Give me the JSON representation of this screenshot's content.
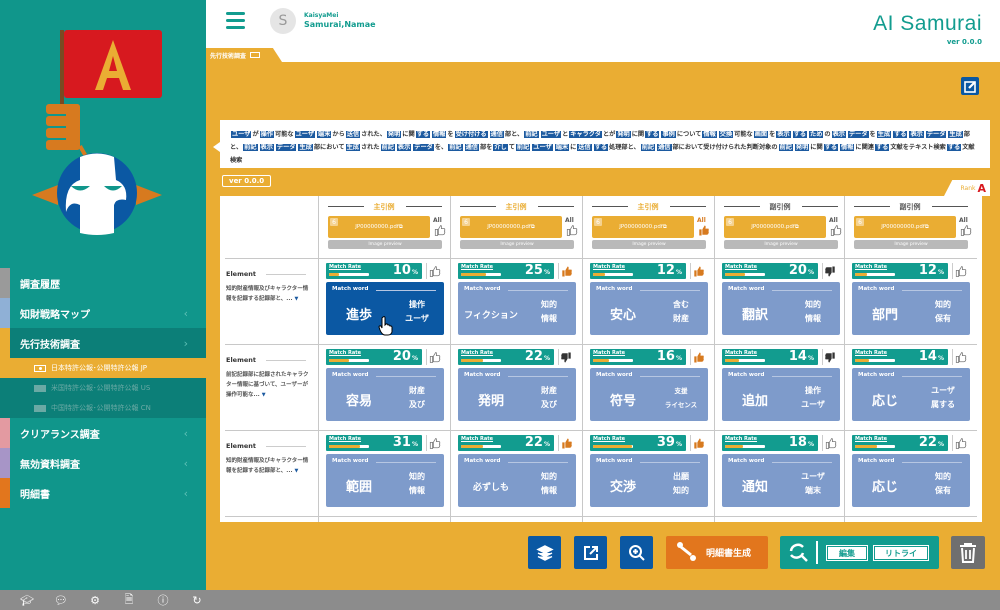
{
  "app": {
    "brand": "AI Samurai",
    "version": "ver 0.0.0"
  },
  "user": {
    "initial": "S",
    "company": "KaisyaMei",
    "name": "Samurai,Namae"
  },
  "breadcrumb_tab": "先行技術調査",
  "sidebar": {
    "items": [
      {
        "label": "調査履歴",
        "strip": "#9a9a9a",
        "chevron": ""
      },
      {
        "label": "知財戦略マップ",
        "strip": "#8fb0d6",
        "chevron": "‹"
      },
      {
        "label": "先行技術調査",
        "strip": "#eaad33",
        "chevron": "›",
        "active": true
      },
      {
        "label": "クリアランス調査",
        "strip": "#e39aa1",
        "chevron": "‹"
      },
      {
        "label": "無効資料調査",
        "strip": "#a795c7",
        "chevron": "‹"
      },
      {
        "label": "明細書",
        "strip": "#e2761d",
        "chevron": "‹"
      }
    ],
    "sub_items": [
      {
        "label": "日本特許公報･公開特許公報 JP",
        "active": true
      },
      {
        "label": "米国特許公報･公開特許公報 US",
        "active": false
      },
      {
        "label": "中国特許公報･公開特許公報 CN",
        "active": false
      }
    ]
  },
  "footer_icons": [
    "graduation-cap-icon",
    "faq-icon",
    "gear-icon",
    "document-icon",
    "help-icon",
    "refresh-icon"
  ],
  "claim": {
    "segments": [
      [
        "ユーザ",
        1
      ],
      [
        "が",
        0
      ],
      [
        "操作",
        1
      ],
      [
        "可能な",
        0
      ],
      [
        "ユーザ",
        1
      ],
      [
        "端末",
        1
      ],
      [
        "から",
        0
      ],
      [
        "送信",
        1
      ],
      [
        "された、",
        0
      ],
      [
        "発明",
        1
      ],
      [
        "に関",
        0
      ],
      [
        "する",
        1
      ],
      [
        "情報",
        1
      ],
      [
        "を",
        0
      ],
      [
        "受け付ける",
        1
      ],
      [
        "通信",
        1
      ],
      [
        "部と、",
        0
      ],
      [
        "前記",
        1
      ],
      [
        "ユーザ",
        1
      ],
      [
        "と",
        0
      ],
      [
        "キャラクタ",
        1
      ],
      [
        "とが",
        0
      ],
      [
        "発明",
        1
      ],
      [
        "に関",
        0
      ],
      [
        "する",
        1
      ],
      [
        "事例",
        1
      ],
      [
        "について",
        0
      ],
      [
        "情報",
        1
      ],
      [
        "交換",
        1
      ],
      [
        "可能な",
        0
      ],
      [
        "画面",
        1
      ],
      [
        "を",
        0
      ],
      [
        "表示",
        1
      ],
      [
        "する",
        1
      ],
      [
        "ため",
        1
      ],
      [
        "の",
        0
      ],
      [
        "表示",
        1
      ],
      [
        "データ",
        1
      ],
      [
        "を",
        0
      ],
      [
        "生成",
        1
      ],
      [
        "する",
        1
      ],
      [
        "表示",
        1
      ],
      [
        "データ",
        1
      ],
      [
        "生成",
        1
      ],
      [
        "部と、",
        0
      ],
      [
        "前記",
        1
      ],
      [
        "表示",
        1
      ],
      [
        "データ",
        1
      ],
      [
        "生成",
        1
      ],
      [
        "部において",
        0
      ],
      [
        "生成",
        1
      ],
      [
        "された",
        0
      ],
      [
        "前記",
        1
      ],
      [
        "表示",
        1
      ],
      [
        "データ",
        1
      ],
      [
        "を、",
        0
      ],
      [
        "前記",
        1
      ],
      [
        "通信",
        1
      ],
      [
        "部を",
        0
      ],
      [
        "介し",
        1
      ],
      [
        "て",
        0
      ],
      [
        "前記",
        1
      ],
      [
        "ユーザ",
        1
      ],
      [
        "端末",
        1
      ],
      [
        "に",
        0
      ],
      [
        "送信",
        1
      ],
      [
        "する",
        1
      ],
      [
        "処理部と、",
        0
      ],
      [
        "前記",
        1
      ],
      [
        "通信",
        1
      ],
      [
        "部において受け付けられた判断対象の",
        0
      ],
      [
        "前記",
        1
      ],
      [
        "発明",
        1
      ],
      [
        "に関",
        0
      ],
      [
        "する",
        1
      ],
      [
        "情報",
        1
      ],
      [
        "に関連",
        0
      ],
      [
        "する",
        1
      ],
      [
        "文献をテキスト検索",
        0
      ],
      [
        "する",
        1
      ],
      [
        "文献検索",
        0
      ]
    ]
  },
  "version_badge": "ver 0.0.0",
  "rank": {
    "label": "Rank",
    "value": "A"
  },
  "columns": [
    {
      "title": "主引例",
      "type": "main",
      "count": "6",
      "pdf": "JP00000000.pdf",
      "all": "All",
      "all_liked": false,
      "preview": "Image preview"
    },
    {
      "title": "主引例",
      "type": "main",
      "count": "6",
      "pdf": "JP00000000.pdf",
      "all": "All",
      "all_liked": false,
      "preview": "Image preview"
    },
    {
      "title": "主引例",
      "type": "main",
      "count": "6",
      "pdf": "JP00000000.pdf",
      "all": "All",
      "all_liked": true,
      "preview": "Image preview"
    },
    {
      "title": "副引例",
      "type": "sub",
      "count": "6",
      "pdf": "JP00000000.pdf",
      "all": "All",
      "all_liked": false,
      "preview": "Image preview"
    },
    {
      "title": "副引例",
      "type": "sub",
      "count": "6",
      "pdf": "JP00000000.pdf",
      "all": "All",
      "all_liked": false,
      "preview": "Image preview"
    }
  ],
  "labels": {
    "element": "Element",
    "match_rate": "Match Rate",
    "match_word": "Match word",
    "percent": "%",
    "more": "▼"
  },
  "rows": [
    {
      "desc": "知的財産情報及びキャラクター情報を記録する記録部と、...",
      "cells": [
        {
          "rate": 10,
          "thumb": "outline",
          "word": "進歩",
          "subs": [
            "操作",
            "ユーザ"
          ],
          "selected": true
        },
        {
          "rate": 25,
          "thumb": "up",
          "word": "フィクション",
          "subs": [
            "知的",
            "情報"
          ]
        },
        {
          "rate": 12,
          "thumb": "up",
          "word": "安心",
          "subs": [
            "含む",
            "財産"
          ]
        },
        {
          "rate": 20,
          "thumb": "down",
          "word": "翻訳",
          "subs": [
            "知的",
            "情報"
          ]
        },
        {
          "rate": 12,
          "thumb": "outline",
          "word": "部門",
          "subs": [
            "知的",
            "保有"
          ]
        }
      ]
    },
    {
      "desc": "前記記録部に記録されたキャラクター情報に基づいて、ユーザーが操作可能な...",
      "cells": [
        {
          "rate": 20,
          "thumb": "outline",
          "word": "容易",
          "subs": [
            "財産",
            "及び"
          ]
        },
        {
          "rate": 22,
          "thumb": "down",
          "word": "発明",
          "subs": [
            "財産",
            "及び"
          ]
        },
        {
          "rate": 16,
          "thumb": "up",
          "word": "符号",
          "subs": [
            "支援",
            "ライセンス"
          ]
        },
        {
          "rate": 14,
          "thumb": "down",
          "word": "追加",
          "subs": [
            "操作",
            "ユーザ"
          ]
        },
        {
          "rate": 14,
          "thumb": "outline",
          "word": "応じ",
          "subs": [
            "ユーザ",
            "属する"
          ]
        }
      ]
    },
    {
      "desc": "知的財産情報及びキャラクター情報を記録する記録部と、...",
      "cells": [
        {
          "rate": 31,
          "thumb": "outline",
          "word": "範囲",
          "subs": [
            "知的",
            "情報"
          ]
        },
        {
          "rate": 22,
          "thumb": "up",
          "word": "必ずしも",
          "subs": [
            "知的",
            "情報"
          ]
        },
        {
          "rate": 39,
          "thumb": "up",
          "word": "交渉",
          "subs": [
            "出願",
            "知的"
          ]
        },
        {
          "rate": 18,
          "thumb": "outline",
          "word": "通知",
          "subs": [
            "ユーザ",
            "端末"
          ]
        },
        {
          "rate": 22,
          "thumb": "outline",
          "word": "応じ",
          "subs": [
            "知的",
            "保有"
          ]
        }
      ]
    }
  ],
  "toolbar": {
    "generate_label": "明細書生成",
    "edit_label": "編集",
    "retry_label": "リトライ"
  },
  "colors": {
    "teal": "#129c8f",
    "amber": "#eaad33",
    "blue": "#0b58a3",
    "orange": "#e2761d",
    "matchword": "#7e9bcb"
  }
}
